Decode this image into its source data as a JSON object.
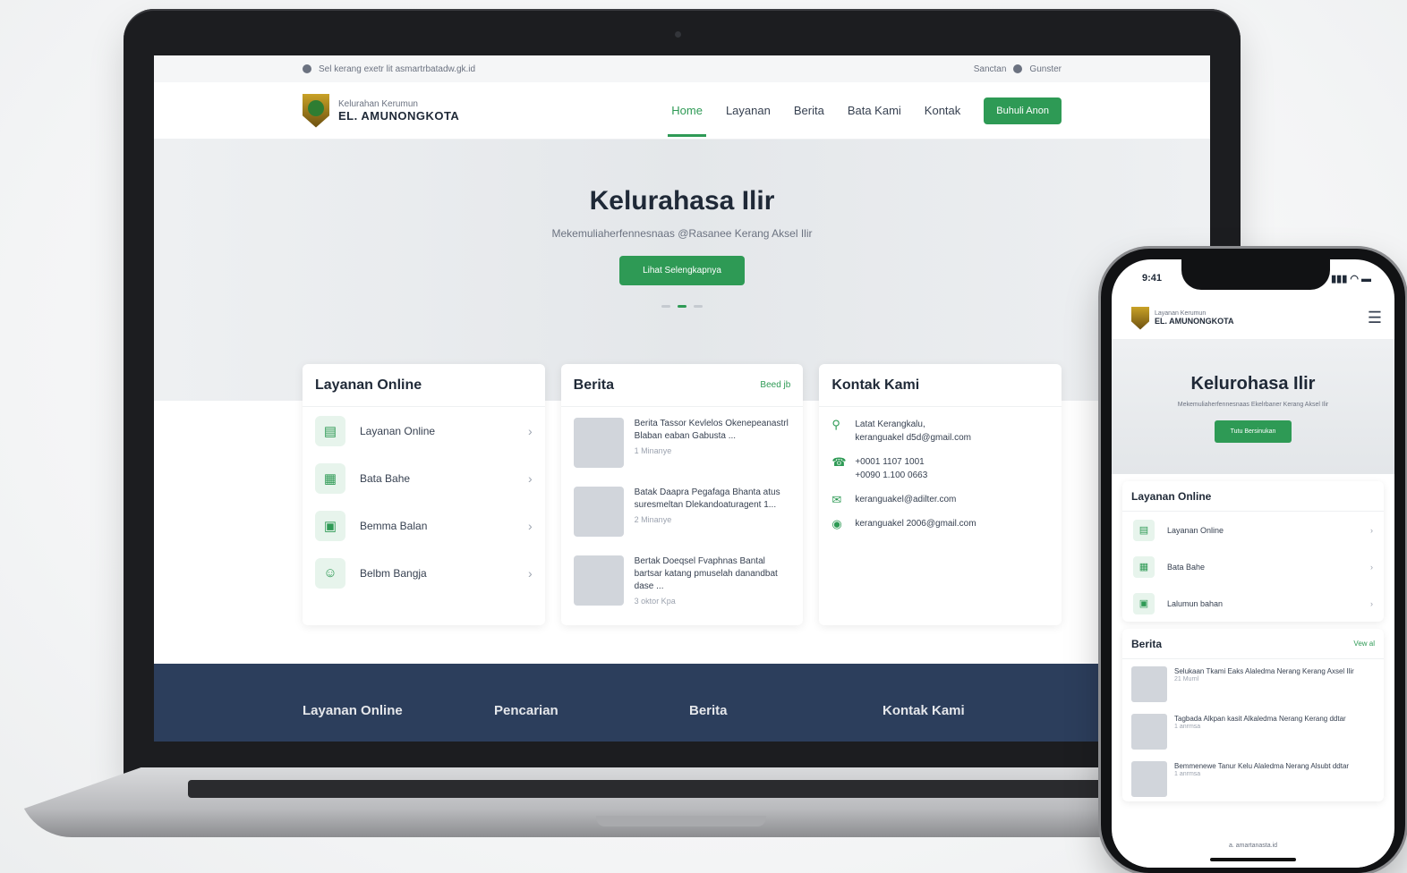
{
  "laptop": {
    "topbar": {
      "left": "Sel kerang exetr lit asmartrbatadw.gk.id",
      "right_link": "Sanctan",
      "right_lang": "Gunster"
    },
    "brand": {
      "small": "Kelurahan Kerumun",
      "big": "EL. AMUNONGKOTA"
    },
    "menu": [
      "Home",
      "Layanan",
      "Berita",
      "Bata Kami",
      "Kontak"
    ],
    "menu_active_index": 0,
    "menu_button": "Buhuli Anon",
    "hero": {
      "title": "Kelurahasa Ilir",
      "subtitle": "Mekemuliaherfennesnaas @Rasanee Kerang Aksel Ilir",
      "cta": "Lihat Selengkapnya",
      "slides": 3,
      "active_slide": 1
    },
    "services": {
      "title": "Layanan Online",
      "items": [
        {
          "label": "Layanan Online",
          "icon": "document-icon"
        },
        {
          "label": "Bata Bahe",
          "icon": "chart-icon"
        },
        {
          "label": "Bemma Balan",
          "icon": "form-icon"
        },
        {
          "label": "Belbm Bangja",
          "icon": "people-icon"
        }
      ]
    },
    "news": {
      "title": "Berita",
      "more": "Beed jb",
      "items": [
        {
          "title": "Berita Tassor Kevlelos Okenepeanastrl Blaban eaban Gabusta ...",
          "date": "1 Minanye"
        },
        {
          "title": "Batak Daapra Pegafaga Bhanta atus suresmeltan Dlekandoaturagent 1...",
          "date": "2 Minanye"
        },
        {
          "title": "Bertak Doeqsel Fvaphnas Bantal bartsar katang pmuselah danandbat dase ...",
          "date": "3 oktor Kpa"
        }
      ]
    },
    "contact": {
      "title": "Kontak Kami",
      "items": [
        {
          "icon": "location-icon",
          "lines": [
            "Latat Kerangkalu,",
            "keranguakel d5d@gmail.com"
          ]
        },
        {
          "icon": "phone-icon",
          "lines": [
            "+0001 1107 1001",
            "+0090 1.100 0663"
          ]
        },
        {
          "icon": "mail-icon",
          "lines": [
            "keranguakel@adilter.com"
          ]
        },
        {
          "icon": "web-icon",
          "lines": [
            "keranguakel 2006@gmail.com"
          ]
        }
      ]
    },
    "footer": [
      "Layanan Online",
      "Pencarian",
      "Berita",
      "Kontak Kami"
    ]
  },
  "phone": {
    "time": "9:41",
    "status_icons": "▮▮▮ ◠ ▬",
    "brand": {
      "small": "Layanan Kerumun",
      "big": "EL. AMUNONGKOTA"
    },
    "menu_icon": "☰",
    "hero": {
      "title": "Kelurohasa Ilir",
      "subtitle": "Mekemuliaherfennesnaas Ekelrbaner Kerang Aksel Ilir",
      "cta": "Tutu Bersinukan"
    },
    "services": {
      "title": "Layanan Online",
      "items": [
        {
          "label": "Layanan Online",
          "icon": "document-icon"
        },
        {
          "label": "Bata Bahe",
          "icon": "chart-icon"
        },
        {
          "label": "Lalumun bahan",
          "icon": "form-icon"
        }
      ]
    },
    "news": {
      "title": "Berita",
      "more": "Vew al",
      "items": [
        {
          "title": "Selukaan Tkami Eaks Alaledma Nerang Kerang Axsel Ilir",
          "date": "21 Murnl"
        },
        {
          "title": "Tagbada Alkpan kasit Alkaledma Nerang Kerang ddtar",
          "date": "1 anrmsa"
        },
        {
          "title": "Bemmenewe Tanur Kelu Alaledma Nerang Alsubt ddtar",
          "date": "1 anrmsa"
        }
      ]
    },
    "footer_url": "a. amartanasta.id"
  },
  "colors": {
    "accent": "#2e9a55",
    "footer_bg": "#2c3e5c",
    "hero_bg": "#e6e9ec"
  }
}
